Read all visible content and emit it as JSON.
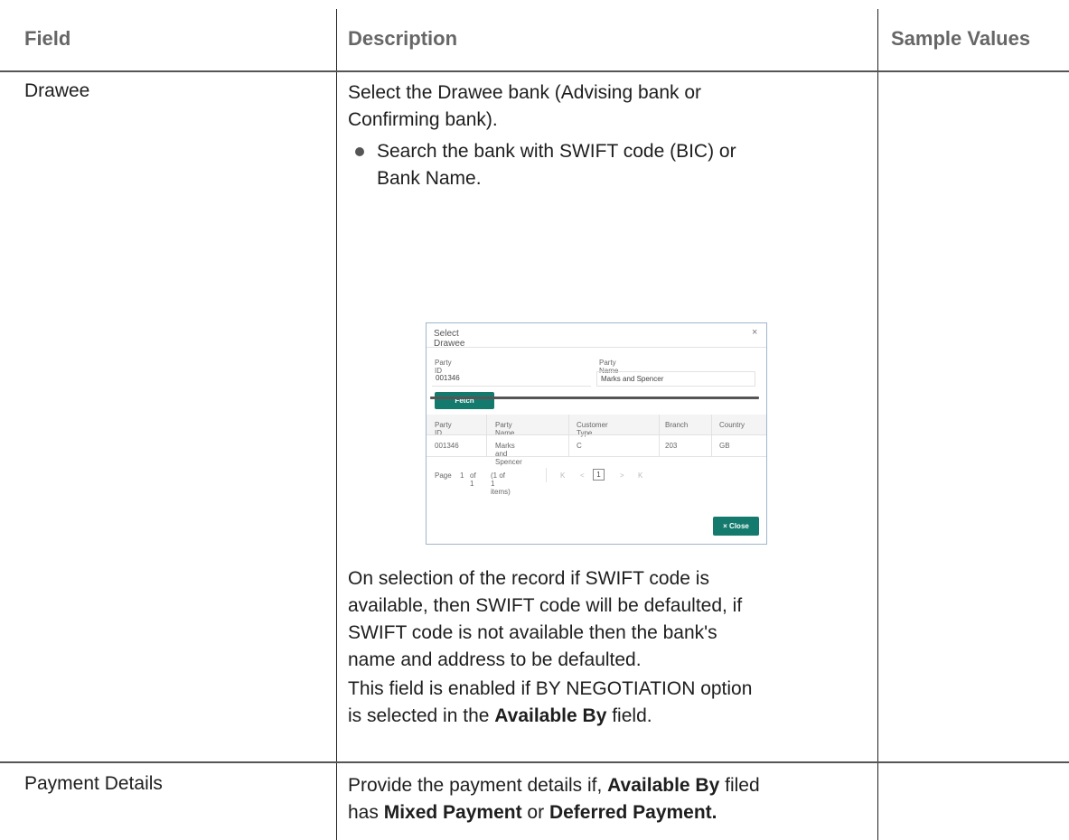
{
  "table": {
    "headers": {
      "field": "Field",
      "description": "Description",
      "sample": "Sample Values"
    },
    "rows": [
      {
        "field": "Drawee",
        "description_lines": [
          "Select the Drawee bank (Advising bank or",
          "Confirming bank)."
        ],
        "bullet_lines": [
          "Search the bank with SWIFT code (BIC) or",
          "Bank Name."
        ],
        "after_image_lines": [
          "On selection of the record if SWIFT code is",
          "available, then SWIFT code will be defaulted, if",
          "SWIFT code is not available then the bank's",
          "name and address to be defaulted."
        ],
        "enabled_note": {
          "line1": "This field is enabled if BY NEGOTIATION option",
          "pre": "is selected in the ",
          "bold": "Available By",
          "post": " field."
        }
      },
      {
        "field": "Payment Details",
        "line1_pre": "Provide the payment details if, ",
        "line1_bold": "Available By",
        "line1_post": " filed",
        "line2_pre": "has ",
        "line2_bold1": "Mixed Payment",
        "line2_mid": " or ",
        "line2_bold2": "Deferred Payment."
      }
    ]
  },
  "dialog": {
    "title": "Select Drawee",
    "close_glyph": "×",
    "party_id_label": "Party ID",
    "party_id_value": "001346",
    "party_name_label": "Party Name",
    "party_name_value": "Marks and Spencer",
    "fetch_label": "Fetch",
    "columns": [
      "Party ID",
      "Party Name",
      "Customer Type",
      "Branch",
      "Country"
    ],
    "rows": [
      [
        "001346",
        "Marks and Spencer",
        "C",
        "203",
        "GB"
      ]
    ],
    "pager": {
      "page_text": "Page",
      "page_num": "1",
      "of_text": "of 1",
      "items_text": "(1 of 1 items)",
      "current": "1",
      "first_glyph": "K",
      "prev_glyph": "<",
      "next_glyph": ">",
      "last_glyph": "K"
    },
    "close_button_label": "× Close"
  },
  "colors": {
    "accent": "#157a6e"
  }
}
